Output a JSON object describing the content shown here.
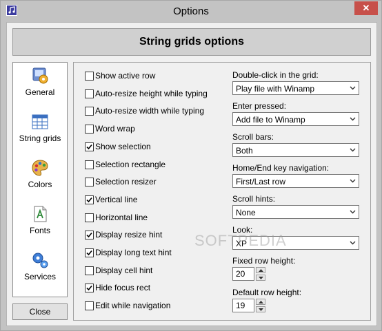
{
  "window": {
    "title": "Options"
  },
  "header": {
    "title": "String grids options"
  },
  "sidebar": {
    "items": [
      {
        "label": "General",
        "icon": "general-icon"
      },
      {
        "label": "String grids",
        "icon": "grid-icon"
      },
      {
        "label": "Colors",
        "icon": "palette-icon"
      },
      {
        "label": "Fonts",
        "icon": "fonts-icon"
      },
      {
        "label": "Services",
        "icon": "gears-icon"
      }
    ],
    "close_label": "Close"
  },
  "options": [
    {
      "label": "Show active row",
      "checked": false
    },
    {
      "label": "Auto-resize height while typing",
      "checked": false
    },
    {
      "label": "Auto-resize width while typing",
      "checked": false
    },
    {
      "label": "Word wrap",
      "checked": false
    },
    {
      "label": "Show selection",
      "checked": true
    },
    {
      "label": "Selection rectangle",
      "checked": false
    },
    {
      "label": "Selection resizer",
      "checked": false
    },
    {
      "label": "Vertical line",
      "checked": true
    },
    {
      "label": "Horizontal line",
      "checked": false
    },
    {
      "label": "Display resize hint",
      "checked": true
    },
    {
      "label": "Display long text hint",
      "checked": true
    },
    {
      "label": "Display cell hint",
      "checked": false
    },
    {
      "label": "Hide focus rect",
      "checked": true
    },
    {
      "label": "Edit while navigation",
      "checked": false
    }
  ],
  "fields": {
    "double_click": {
      "label": "Double-click in the grid:",
      "value": "Play file with Winamp"
    },
    "enter_pressed": {
      "label": "Enter pressed:",
      "value": "Add file to Winamp"
    },
    "scroll_bars": {
      "label": "Scroll bars:",
      "value": "Both"
    },
    "home_end": {
      "label": "Home/End key navigation:",
      "value": "First/Last row"
    },
    "scroll_hints": {
      "label": "Scroll hints:",
      "value": "None"
    },
    "look": {
      "label": "Look:",
      "value": "XP"
    },
    "fixed_row_height": {
      "label": "Fixed row height:",
      "value": "20"
    },
    "default_row_height": {
      "label": "Default row height:",
      "value": "19"
    }
  },
  "watermark": "SOFTPEDIA",
  "colors": {
    "close_button": "#c7504a",
    "header_bg": "#d0d0d0"
  }
}
